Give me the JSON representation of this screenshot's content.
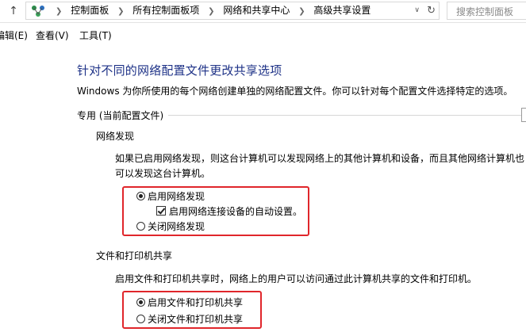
{
  "address_bar": {
    "crumbs": [
      "控制面板",
      "所有控制面板项",
      "网络和共享中心",
      "高级共享设置"
    ],
    "search_placeholder": "搜索控制面板"
  },
  "menu": {
    "items": [
      "编辑(E)",
      "查看(V)",
      "工具(T)"
    ]
  },
  "page": {
    "title": "针对不同的网络配置文件更改共享选项",
    "description": "Windows 为你所使用的每个网络创建单独的网络配置文件。你可以针对每个配置文件选择特定的选项。",
    "profile_header": "专用 (当前配置文件)"
  },
  "network_discovery": {
    "heading": "网络发现",
    "desc_line1": "如果已启用网络发现，则这台计算机可以发现网络上的其他计算机和设备，而且其他网络计算机也",
    "desc_line2": "可以发现这台计算机。",
    "option_on": "启用网络发现",
    "auto_setup": "启用网络连接设备的自动设置。",
    "option_off": "关闭网络发现",
    "selected": "on",
    "auto_setup_checked": true
  },
  "file_printer_sharing": {
    "heading": "文件和打印机共享",
    "desc": "启用文件和打印机共享时，网络上的用户可以访问通过此计算机共享的文件和打印机。",
    "option_on": "启用文件和打印机共享",
    "option_off": "关闭文件和打印机共享",
    "selected": "on"
  },
  "colors": {
    "title_blue": "#1e3287",
    "highlight_red": "#e0262b"
  }
}
